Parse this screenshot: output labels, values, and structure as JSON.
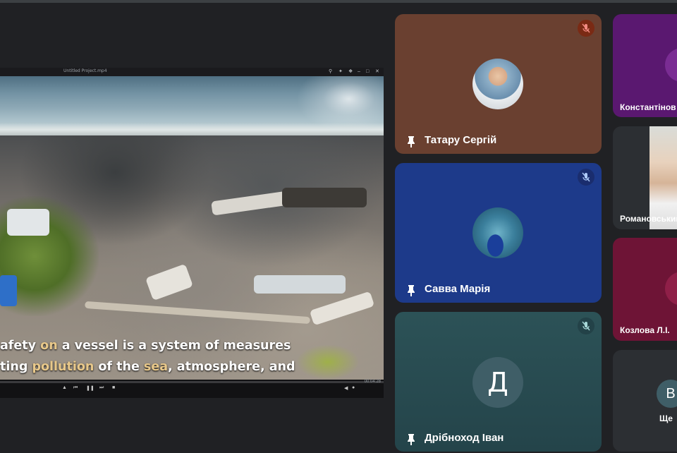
{
  "shared_screen": {
    "window_title": "Untitled Project.mp4",
    "subtitle_line1_pre": "afety ",
    "subtitle_line1_hl": "on",
    "subtitle_line1_post": " a vessel is a system of measures",
    "subtitle_line2_pre": "ting ",
    "subtitle_line2_hl1": "pollution",
    "subtitle_line2_mid": " of the ",
    "subtitle_line2_hl2": "sea",
    "subtitle_line2_post": ", atmosphere, and",
    "timecode": "00:04:28"
  },
  "participants": [
    {
      "name": "Татару Сергій",
      "muted": true,
      "bg": "#6a4030"
    },
    {
      "name": "Савва Марія",
      "muted": true,
      "bg": "#1d3a8a"
    },
    {
      "name": "Дрібноход Іван",
      "muted": true,
      "bg": "#294a50",
      "avatar_letter": "Д"
    }
  ],
  "side_participants": [
    {
      "name": "Константінов",
      "bg": "#5a1870"
    },
    {
      "name": "Романовський",
      "bg": "#2c2f33"
    },
    {
      "name": "Козлова Л.І.",
      "bg": "#6e1436"
    },
    {
      "name": "Ще ",
      "avatar_letter": "В",
      "bg": "#2c2f33"
    }
  ]
}
